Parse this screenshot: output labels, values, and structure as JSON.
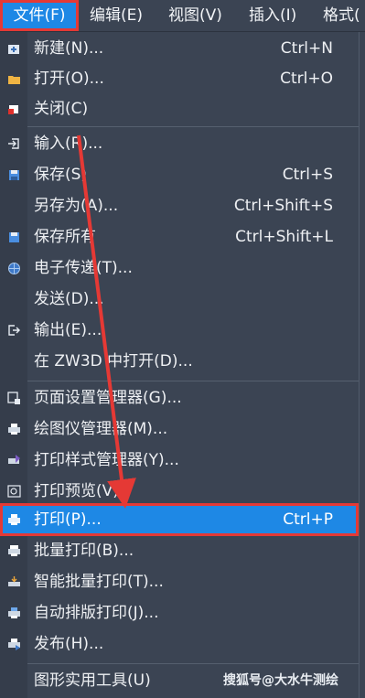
{
  "menubar": {
    "items": [
      {
        "label": "文件(F)",
        "active": true
      },
      {
        "label": "编辑(E)"
      },
      {
        "label": "视图(V)"
      },
      {
        "label": "插入(I)"
      },
      {
        "label": "格式("
      }
    ]
  },
  "menu": {
    "items": [
      {
        "icon": "new-file-icon",
        "label": "新建(N)...",
        "shortcut": "Ctrl+N"
      },
      {
        "icon": "folder-icon",
        "label": "打开(O)...",
        "shortcut": "Ctrl+O"
      },
      {
        "icon": "close-file-icon",
        "label": "关闭(C)",
        "shortcut": ""
      },
      {
        "icon": "import-icon",
        "label": "输入(R)...",
        "shortcut": ""
      },
      {
        "icon": "save-icon",
        "label": "保存(S)",
        "shortcut": "Ctrl+S"
      },
      {
        "icon": "",
        "label": "另存为(A)...",
        "shortcut": "Ctrl+Shift+S"
      },
      {
        "icon": "save-all-icon",
        "label": "保存所有",
        "shortcut": "Ctrl+Shift+L"
      },
      {
        "icon": "globe-icon",
        "label": "电子传递(T)...",
        "shortcut": ""
      },
      {
        "icon": "",
        "label": "发送(D)...",
        "shortcut": ""
      },
      {
        "icon": "export-icon",
        "label": "输出(E)...",
        "shortcut": ""
      },
      {
        "icon": "",
        "label": "在 ZW3D 中打开(D)...",
        "shortcut": ""
      },
      {
        "icon": "page-setup-icon",
        "label": "页面设置管理器(G)...",
        "shortcut": ""
      },
      {
        "icon": "plotter-icon",
        "label": "绘图仪管理器(M)...",
        "shortcut": ""
      },
      {
        "icon": "plot-style-icon",
        "label": "打印样式管理器(Y)...",
        "shortcut": ""
      },
      {
        "icon": "print-preview-icon",
        "label": "打印预览(V)",
        "shortcut": ""
      },
      {
        "icon": "printer-icon",
        "label": "打印(P)...",
        "shortcut": "Ctrl+P",
        "selected": true
      },
      {
        "icon": "batch-print-icon",
        "label": "批量打印(B)...",
        "shortcut": ""
      },
      {
        "icon": "smart-batch-print-icon",
        "label": "智能批量打印(T)...",
        "shortcut": ""
      },
      {
        "icon": "auto-layout-print-icon",
        "label": "自动排版打印(J)...",
        "shortcut": ""
      },
      {
        "icon": "publish-icon",
        "label": "发布(H)...",
        "shortcut": ""
      },
      {
        "icon": "",
        "label": "图形实用工具(U)",
        "shortcut": ""
      }
    ]
  },
  "watermark": "搜狐号@大水牛测绘",
  "colors": {
    "background": "#3b4453",
    "highlight": "#1e88e5",
    "annotation_red": "#e53935"
  }
}
